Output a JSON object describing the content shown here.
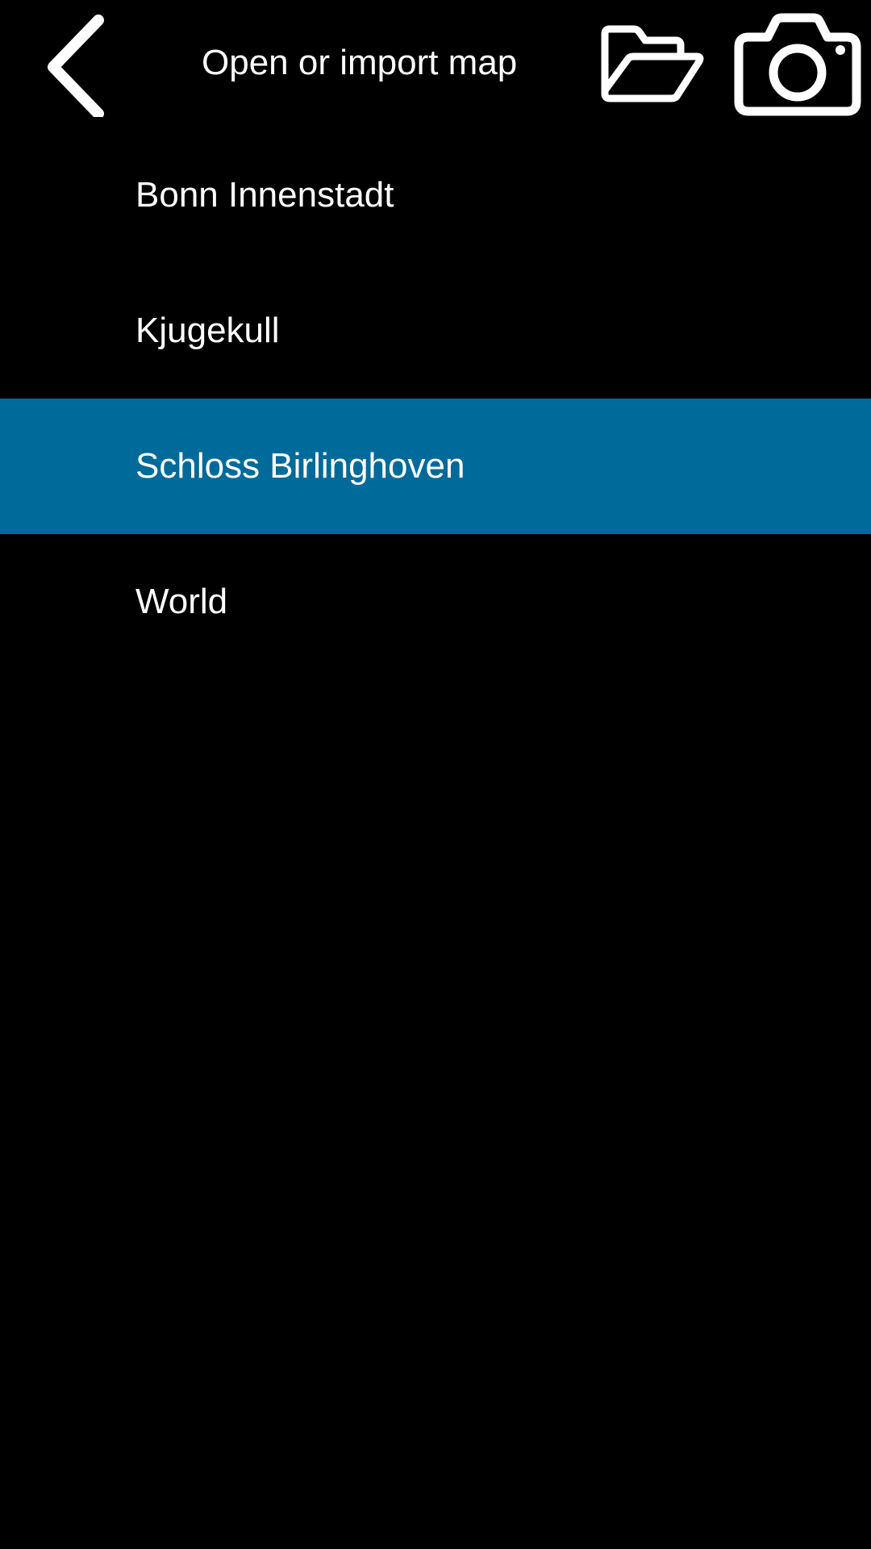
{
  "header": {
    "title": "Open or import map",
    "back_icon": "chevron-left-icon",
    "open_folder_icon": "folder-open-icon",
    "camera_icon": "camera-icon"
  },
  "maps": [
    {
      "label": "Bonn Innenstadt",
      "selected": false
    },
    {
      "label": "Kjugekull",
      "selected": false
    },
    {
      "label": "Schloss Birlinghoven",
      "selected": true
    },
    {
      "label": "World",
      "selected": false
    }
  ],
  "colors": {
    "background": "#000000",
    "selected_row": "#006a9a",
    "text": "#ffffff"
  }
}
